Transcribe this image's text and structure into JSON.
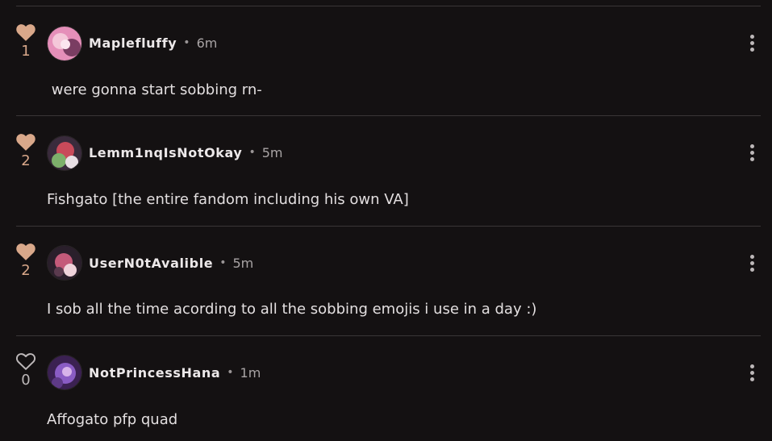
{
  "comments": [
    {
      "likes": "1",
      "liked": true,
      "username": "Maplefluffy",
      "separator": "•",
      "time": "6m",
      "text": " were gonna start sobbing rn-",
      "avatar_colors": [
        "#e58fb9",
        "#f4c7d9",
        "#7a3d62"
      ]
    },
    {
      "likes": "2",
      "liked": true,
      "username": "Lemm1nqIsNotOkay",
      "separator": "•",
      "time": "5m",
      "text": "Fishgato [the entire fandom including his own VA]",
      "avatar_colors": [
        "#3a2b3c",
        "#7db06b",
        "#c94a5a"
      ]
    },
    {
      "likes": "2",
      "liked": true,
      "username": "UserN0tAvalible",
      "separator": "•",
      "time": "5m",
      "text": "I sob all the time acording to all the sobbing emojis i use in a day :)",
      "avatar_colors": [
        "#2a1f2b",
        "#c45a7a",
        "#efd3db"
      ]
    },
    {
      "likes": "0",
      "liked": false,
      "username": "NotPrincessHana",
      "separator": "•",
      "time": "1m",
      "text": "Affogato pfp quad",
      "avatar_colors": [
        "#3b2152",
        "#8a5cc4",
        "#d7b3ea"
      ]
    }
  ],
  "colors": {
    "background": "#141112",
    "like_active": "#d9a88a",
    "like_inactive": "#bdb8b9",
    "divider": "#3a3637"
  },
  "icons": {
    "like": "heart-icon",
    "menu": "more-vertical-icon"
  }
}
